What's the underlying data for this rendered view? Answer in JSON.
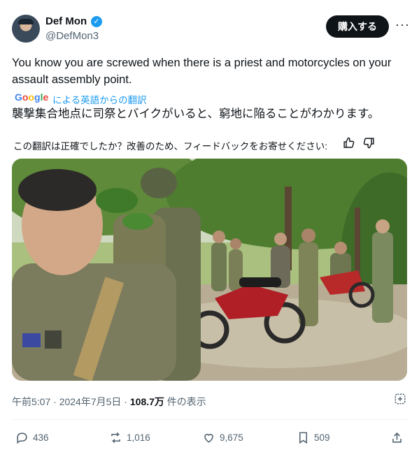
{
  "author": {
    "name": "Def Mon",
    "handle": "@DefMon3"
  },
  "header": {
    "buy_label": "購入する",
    "more_label": "···"
  },
  "tweet": {
    "text": "You know you are screwed when there is a priest and motorcycles on your assault assembly point.",
    "translation_brand": "Google",
    "translation_by": "による英語からの翻訳",
    "translated_text": "襲撃集合地点に司祭とバイクがいると、窮地に陥ることがわかります。",
    "feedback_prompt": "この翻訳は正確でしたか？改善のため、フィードバックをお寄せください:"
  },
  "meta": {
    "time": "午前5:07",
    "separator": " · ",
    "date": "2024年7月5日",
    "views_count": "108.7万",
    "views_label": " 件の表示"
  },
  "actions": {
    "replies": "436",
    "reposts": "1,016",
    "likes": "9,675",
    "bookmarks": "509"
  },
  "colors": {
    "accent": "#1d9bf0",
    "text": "#0f1419",
    "muted": "#536471"
  },
  "icons": [
    "verified-badge-icon",
    "more-icon",
    "thumbs-up-icon",
    "thumbs-down-icon",
    "grok-icon",
    "reply-icon",
    "repost-icon",
    "like-icon",
    "bookmark-icon",
    "share-icon"
  ]
}
